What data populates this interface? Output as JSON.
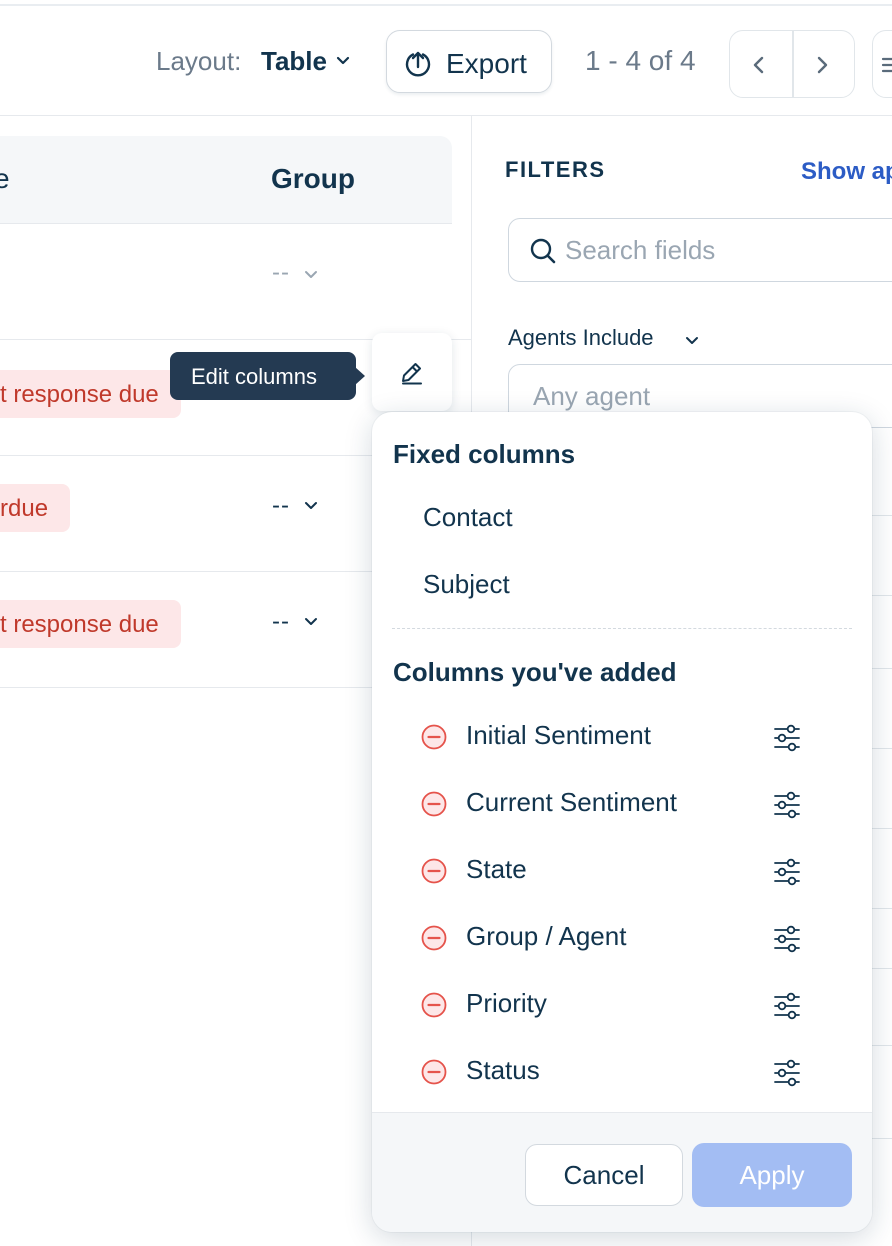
{
  "toolbar": {
    "layout_label": "Layout:",
    "layout_value": "Table",
    "export_label": "Export",
    "pagination_text": "1 - 4 of 4"
  },
  "table": {
    "header_fragment": "e",
    "group_header": "Group",
    "rows": [
      {
        "status_pill": "",
        "group_value": "--"
      },
      {
        "status_pill": "t response due",
        "group_value": ""
      },
      {
        "status_pill": "rdue",
        "group_value": "--"
      },
      {
        "status_pill": "t response due",
        "group_value": "--"
      }
    ]
  },
  "tooltip": {
    "text": "Edit columns"
  },
  "filters": {
    "title": "FILTERS",
    "show_link": "Show ap",
    "search_placeholder": "Search fields",
    "agents_label": "Agents Include",
    "agents_placeholder": "Any agent"
  },
  "column_editor": {
    "fixed_title": "Fixed columns",
    "fixed_columns": [
      "Contact",
      "Subject"
    ],
    "added_title": "Columns you've added",
    "added_columns": [
      "Initial Sentiment",
      "Current Sentiment",
      "State",
      "Group / Agent",
      "Priority",
      "Status"
    ],
    "cancel_label": "Cancel",
    "apply_label": "Apply"
  },
  "colors": {
    "primary_text": "#12344d",
    "link": "#2c5cc5",
    "pill_bg": "#fde7e8",
    "pill_text": "#c0392b",
    "apply_disabled": "#a3bdf3",
    "remove_icon": "#e5534b"
  },
  "icons": {
    "export": "upload-circle-icon",
    "prev": "chevron-left-icon",
    "next": "chevron-right-icon",
    "edit": "pencil-icon",
    "search": "search-icon",
    "remove": "minus-circle-icon",
    "settings": "sliders-icon"
  }
}
